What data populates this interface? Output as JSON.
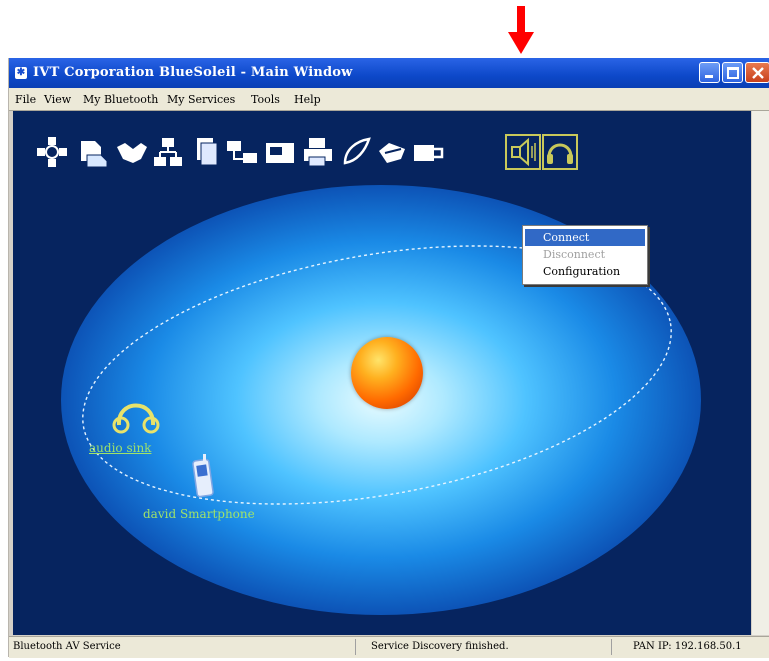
{
  "window": {
    "title": "IVT Corporation BlueSoleil - Main Window",
    "title_icon": "bluesoleil-icon"
  },
  "menubar": {
    "items": [
      "File",
      "View",
      "My Bluetooth",
      "My Services",
      "Tools",
      "Help"
    ]
  },
  "toolbar": {
    "service_icons": [
      "network-access-icon",
      "file-transfer-icon",
      "handshake-icon",
      "lan-access-icon",
      "document-icon",
      "pan-network-icon",
      "fax-icon",
      "printer-icon",
      "stylus-icon",
      "sync-icon",
      "ftp-icon",
      "av-audio-icon",
      "headset-icon"
    ]
  },
  "context_menu": {
    "items": [
      {
        "label": "Connect",
        "state": "selected"
      },
      {
        "label": "Disconnect",
        "state": "disabled"
      },
      {
        "label": "Configuration",
        "state": "normal"
      }
    ]
  },
  "devices": [
    {
      "label": "audio sink",
      "icon": "headphones-icon"
    },
    {
      "label": "david Smartphone",
      "icon": "mobile-phone-icon"
    }
  ],
  "statusbar": {
    "left": "Bluetooth AV Service",
    "middle": "Service Discovery finished.",
    "right": "PAN IP: 192.168.50.1"
  },
  "colors": {
    "annotation_arrow": "#ff0000",
    "titlebar": "#0d48c9",
    "canvas_background": "#06245f",
    "device_label": "#9fe36a",
    "menu_selection": "#3169c6"
  }
}
